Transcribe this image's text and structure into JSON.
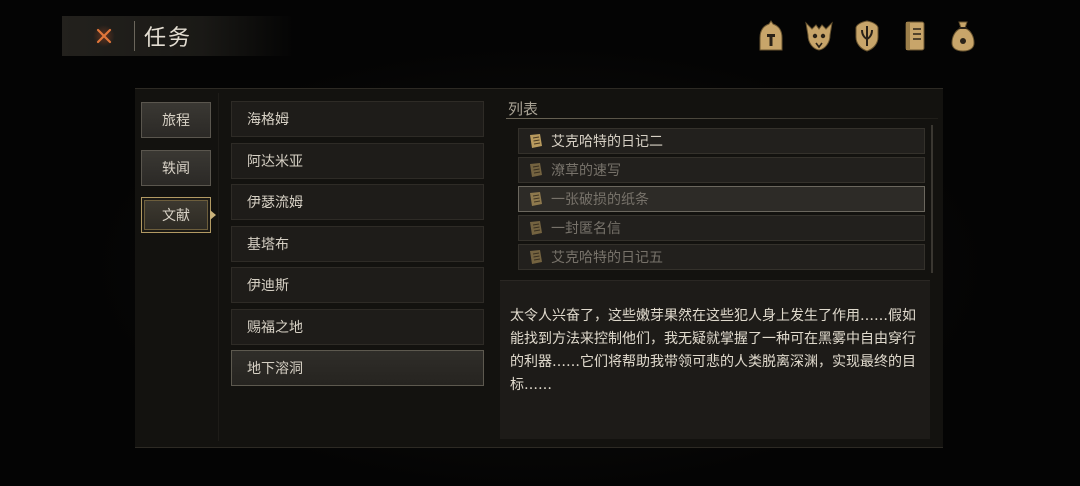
{
  "header": {
    "title": "任务",
    "close_icon": "close-x-icon"
  },
  "top_icons": [
    {
      "name": "helmet-icon"
    },
    {
      "name": "beast-skull-icon"
    },
    {
      "name": "shield-icon"
    },
    {
      "name": "journal-icon"
    },
    {
      "name": "sack-icon"
    }
  ],
  "categories": [
    {
      "label": "旅程",
      "active": false
    },
    {
      "label": "轶闻",
      "active": false
    },
    {
      "label": "文献",
      "active": true
    }
  ],
  "locations": [
    {
      "label": "海格姆",
      "active": false
    },
    {
      "label": "阿达米亚",
      "active": false
    },
    {
      "label": "伊瑟流姆",
      "active": false
    },
    {
      "label": "基塔布",
      "active": false
    },
    {
      "label": "伊迪斯",
      "active": false
    },
    {
      "label": "赐福之地",
      "active": false
    },
    {
      "label": "地下溶洞",
      "active": true
    }
  ],
  "documents": {
    "title": "列表",
    "items": [
      {
        "label": "艾克哈特的日记二",
        "state": "read"
      },
      {
        "label": "潦草的速写",
        "state": "unread"
      },
      {
        "label": "一张破损的纸条",
        "state": "selected"
      },
      {
        "label": "一封匿名信",
        "state": "unread"
      },
      {
        "label": "艾克哈特的日记五",
        "state": "unread"
      }
    ]
  },
  "description": "太令人兴奋了，这些嫩芽果然在这些犯人身上发生了作用……假如能找到方法来控制他们，我无疑就掌握了一种可在黑雾中自由穿行的利器……它们将帮助我带领可悲的人类脱离深渊，实现最终的目标……",
  "colors": {
    "accent_gold": "#b29a63",
    "close_orange": "#e0763a",
    "text": "#d6d0c4"
  }
}
